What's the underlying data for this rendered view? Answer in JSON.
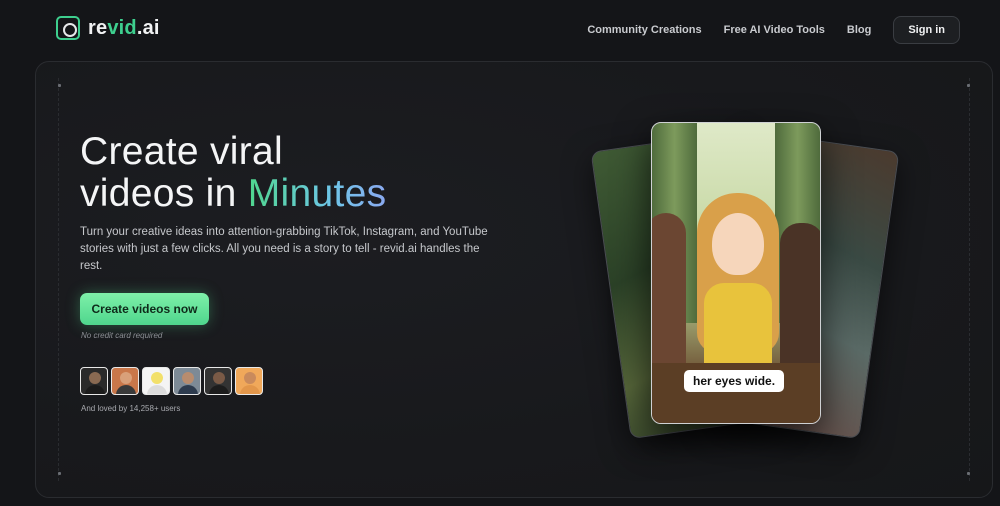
{
  "header": {
    "logo_prefix": "re",
    "logo_accent": "vid",
    "logo_suffix": ".ai",
    "nav": [
      "Community Creations",
      "Free AI Video Tools",
      "Blog"
    ],
    "signin_label": "Sign in"
  },
  "hero": {
    "title_line1": "Create viral",
    "title_line2_plain": "videos in ",
    "title_line2_accent": "Minutes",
    "subtitle": "Turn your creative ideas into attention-grabbing TikTok, Instagram, and YouTube stories with just a few clicks. All you need is a story to tell - revid.ai handles the rest.",
    "cta_label": "Create videos now",
    "cta_note": "No credit card required",
    "loved_text": "And loved by 14,258+ users"
  },
  "preview": {
    "caption": "her eyes wide."
  },
  "colors": {
    "accent": "#4fd68d",
    "background": "#141518"
  }
}
